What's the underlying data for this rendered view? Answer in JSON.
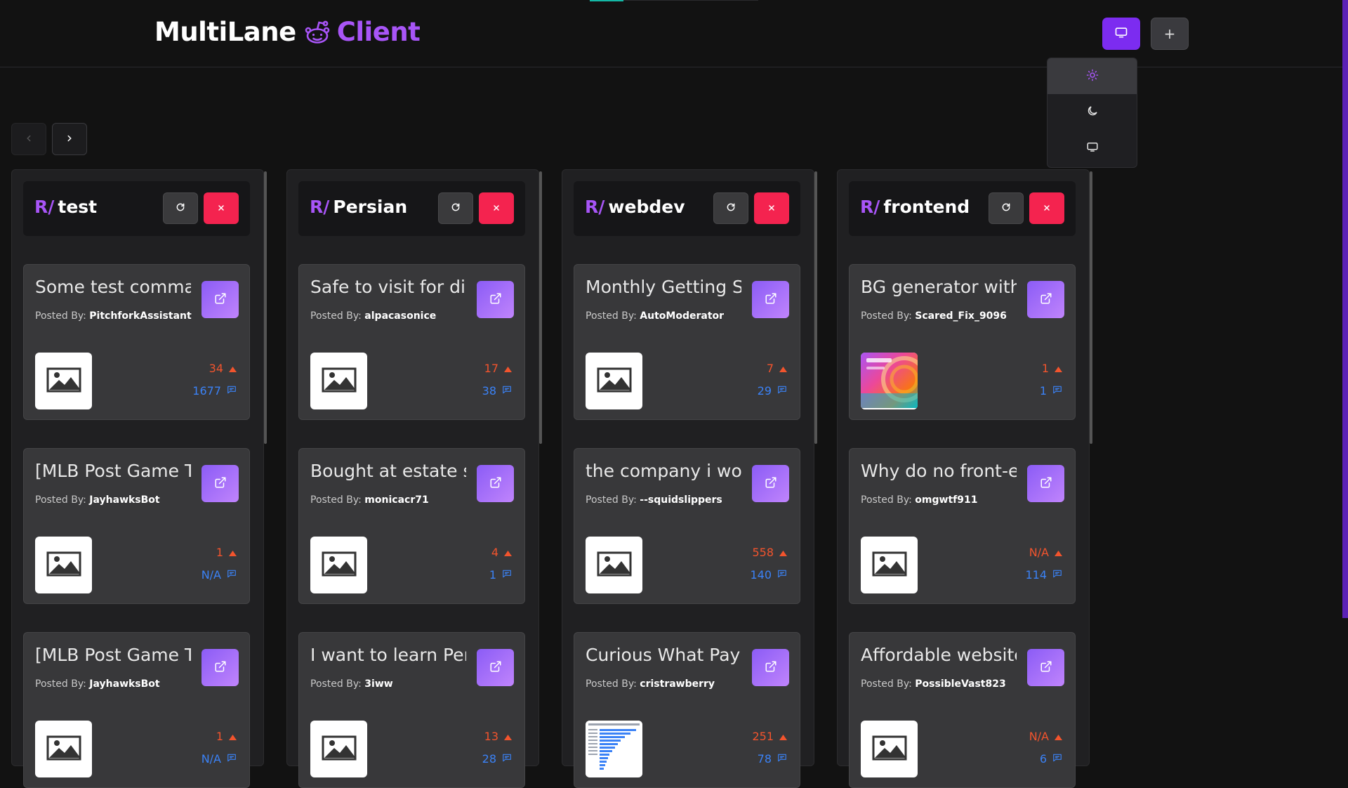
{
  "app": {
    "title_part1": "MultiLane",
    "title_part2": "Client",
    "colors": {
      "accent": "#a855f7",
      "danger": "#f4234f",
      "votes": "#f2542d",
      "comments": "#3b82f6"
    }
  },
  "header": {
    "theme_button_icon": "monitor-icon",
    "add_button_icon": "plus-icon",
    "add_button_label": "+"
  },
  "theme_menu": {
    "items": [
      {
        "icon": "sun-icon",
        "selected": true
      },
      {
        "icon": "moon-icon",
        "selected": false
      },
      {
        "icon": "monitor-icon",
        "selected": false
      }
    ]
  },
  "nav": {
    "prev_icon": "chevron-left-icon",
    "next_icon": "chevron-right-icon"
  },
  "lane_prefix": "R/",
  "posted_by_label": "Posted By:",
  "lanes": [
    {
      "subreddit": "test",
      "posts": [
        {
          "title": "Some test comma",
          "author": "PitchforkAssistant",
          "votes": "34",
          "comments": "1677",
          "thumb": "placeholder"
        },
        {
          "title": "[MLB Post Game Th",
          "author": "JayhawksBot",
          "votes": "1",
          "comments": "N/A",
          "thumb": "placeholder"
        },
        {
          "title": "[MLB Post Game Th",
          "author": "JayhawksBot",
          "votes": "1",
          "comments": "N/A",
          "thumb": "placeholder"
        }
      ]
    },
    {
      "subreddit": "Persian",
      "posts": [
        {
          "title": "Safe to visit for dia",
          "author": "alpacasonice",
          "votes": "17",
          "comments": "38",
          "thumb": "placeholder"
        },
        {
          "title": "Bought at estate s",
          "author": "monicacr71",
          "votes": "4",
          "comments": "1",
          "thumb": "placeholder"
        },
        {
          "title": "I want to learn Pers",
          "author": "3iww",
          "votes": "13",
          "comments": "28",
          "thumb": "placeholder"
        }
      ]
    },
    {
      "subreddit": "webdev",
      "posts": [
        {
          "title": "Monthly Getting St",
          "author": "AutoModerator",
          "votes": "7",
          "comments": "29",
          "thumb": "placeholder"
        },
        {
          "title": "the company i wor",
          "author": "--squidslippers",
          "votes": "558",
          "comments": "140",
          "thumb": "placeholder"
        },
        {
          "title": "Curious What Payr",
          "author": "cristrawberry",
          "votes": "251",
          "comments": "78",
          "thumb": "chart-image"
        }
      ]
    },
    {
      "subreddit": "frontend",
      "posts": [
        {
          "title": "BG generator with",
          "author": "Scared_Fix_9096",
          "votes": "1",
          "comments": "1",
          "thumb": "gradient-image"
        },
        {
          "title": "Why do no front-e",
          "author": "omgwtf911",
          "votes": "N/A",
          "comments": "114",
          "thumb": "placeholder"
        },
        {
          "title": "Affordable website",
          "author": "PossibleVast823",
          "votes": "N/A",
          "comments": "6",
          "thumb": "placeholder"
        }
      ]
    }
  ]
}
